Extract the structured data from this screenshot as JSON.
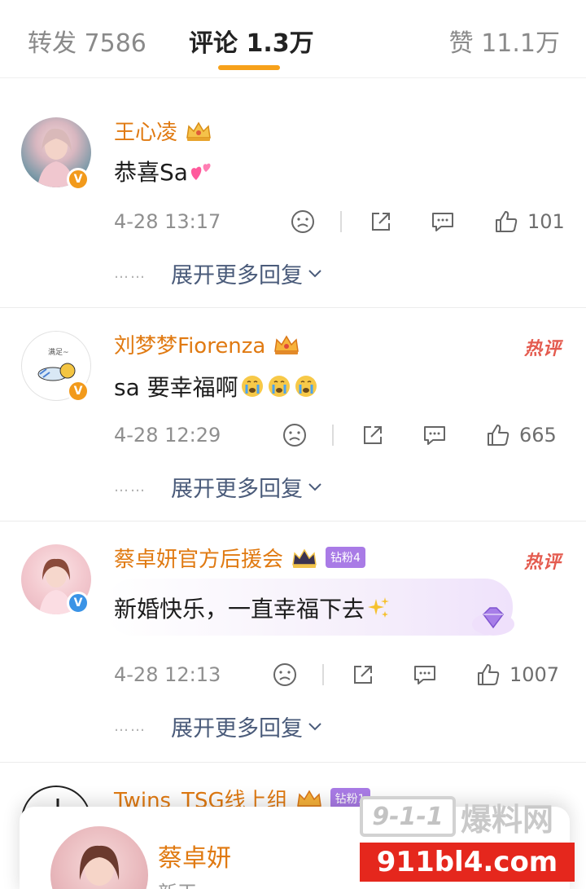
{
  "tabs": {
    "repost": "转发 7586",
    "comments": "评论 1.3万",
    "likes": "赞 11.1万"
  },
  "comments": [
    {
      "username": "王心凌",
      "text": "恭喜Sa",
      "emoji": "two-hearts-emoji",
      "timestamp": "4-28 13:17",
      "likes": "101",
      "expand": "展开更多回复",
      "dots": "……",
      "badge": "V",
      "badge_color": "#f29a1b"
    },
    {
      "username": "刘梦梦Fiorenza",
      "hot_tag": "热评",
      "text": "sa 要幸福啊",
      "emoji": "crying-emoji",
      "timestamp": "4-28 12:29",
      "likes": "665",
      "expand": "展开更多回复",
      "dots": "……",
      "badge": "V",
      "badge_color": "#f29a1b",
      "avatar_text": "满足~"
    },
    {
      "username": "蔡卓妍官方后援会",
      "fan_badge": "钻粉4",
      "hot_tag": "热评",
      "text": "新婚快乐，一直幸福下去",
      "emoji": "sparkles-emoji",
      "timestamp": "4-28 12:13",
      "likes": "1007",
      "expand": "展开更多回复",
      "dots": "……",
      "badge": "V",
      "badge_color": "#3a93e6"
    },
    {
      "username": "Twins_TSG线上组",
      "fan_badge": "钻粉1"
    }
  ],
  "popup": {
    "name": "蔡卓妍",
    "subtitle": "新干"
  },
  "watermark": {
    "box_text": "9-1-1",
    "cn_text": "爆料网",
    "url": "911bl4.com"
  },
  "colors": {
    "accent": "#f7a11a",
    "username": "#e07a12",
    "hot": "#e45b4f"
  }
}
